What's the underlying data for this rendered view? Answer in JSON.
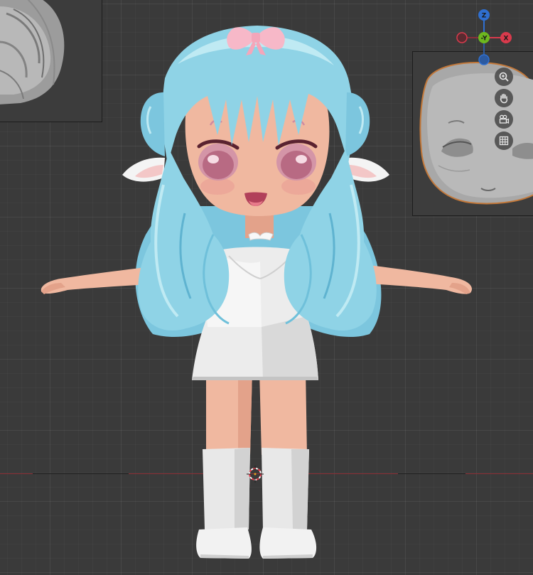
{
  "viewport": {
    "background": "#3a3a3a",
    "x_axis_color": "#8a2c33"
  },
  "gizmo": {
    "z_label": "Z",
    "y_label": "-Y",
    "x_label": "X",
    "z_color": "#2f6fd0",
    "y_color": "#6db81f",
    "x_color": "#d93a4c",
    "neg_x_color": "#8a2f3b",
    "neg_z_color": "#2c5aa0"
  },
  "navigation": {
    "zoom": "zoom-icon",
    "pan": "hand-icon",
    "camera": "camera-icon",
    "ortho": "grid-icon"
  },
  "reference_images": {
    "left": "hair-sculpt-reference",
    "right": "face-sculpt-reference"
  },
  "colors": {
    "hair": "#8fd3e6",
    "hair_light": "#bfeaf3",
    "hair_dark": "#5fb3d0",
    "skin": "#f0b8a0",
    "skin_shadow": "#e3a28a",
    "dress": "#ececec",
    "dress_shadow": "#cfcfcf",
    "bow": "#f7b8c8",
    "eye": "#c98a9c"
  }
}
